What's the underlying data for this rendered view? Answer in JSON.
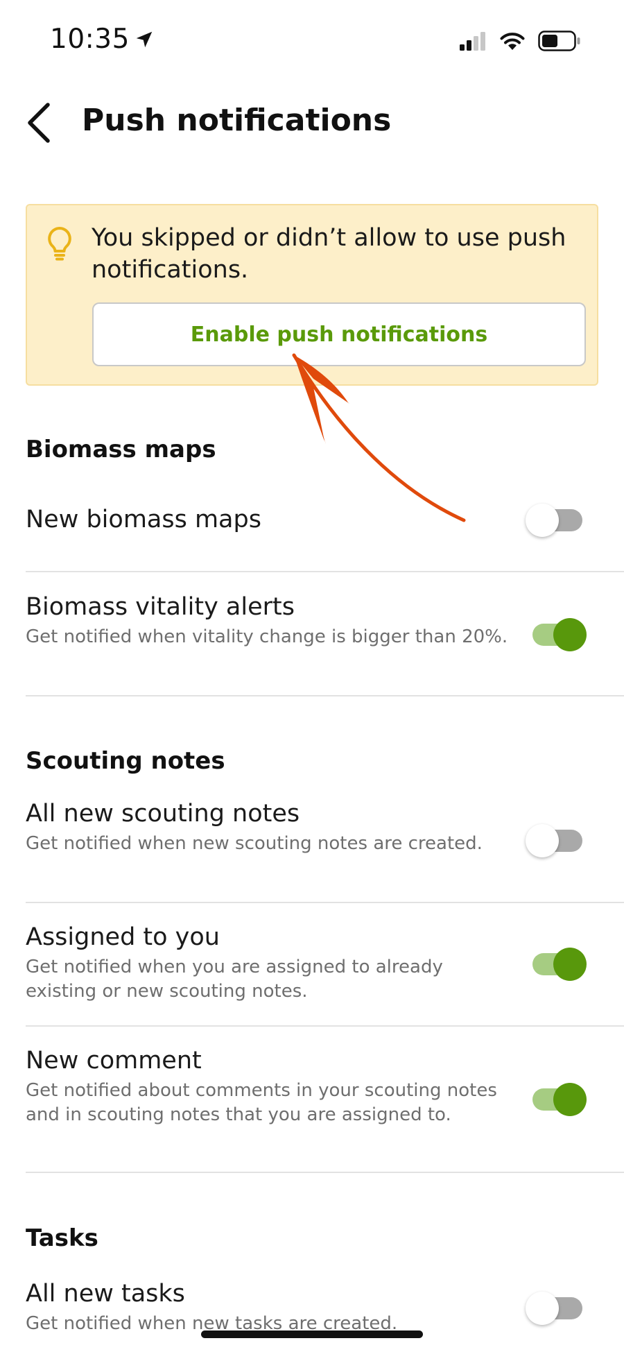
{
  "status_bar": {
    "time": "10:35",
    "icons": [
      "location-arrow-icon",
      "cellular-signal-icon",
      "wifi-icon",
      "battery-icon"
    ]
  },
  "header": {
    "title": "Push notifications",
    "back_icon": "chevron-left-icon"
  },
  "banner": {
    "icon": "lightbulb-icon",
    "message": "You skipped or didn’t allow to use push notifications.",
    "button_label": "Enable push notifications"
  },
  "sections": {
    "biomass": {
      "title": "Biomass maps",
      "items": [
        {
          "title": "New biomass maps",
          "description": "",
          "enabled": false
        },
        {
          "title": "Biomass vitality alerts",
          "description": "Get notified when vitality change is bigger than 20%.",
          "enabled": true
        }
      ]
    },
    "scouting": {
      "title": "Scouting notes",
      "items": [
        {
          "title": "All new scouting notes",
          "description": "Get notified when new scouting notes are created.",
          "enabled": false
        },
        {
          "title": "Assigned to you",
          "description": "Get notified when you are assigned to already existing or new scouting notes.",
          "enabled": true
        },
        {
          "title": "New comment",
          "description": "Get notified about comments in your scouting notes and in scouting notes that you are assigned to.",
          "enabled": true
        }
      ]
    },
    "tasks": {
      "title": "Tasks",
      "items": [
        {
          "title": "All new tasks",
          "description": "Get notified when new tasks are created.",
          "enabled": false
        }
      ]
    }
  },
  "colors": {
    "accent_green": "#58980c",
    "banner_bg": "#fdefc9",
    "arrow": "#e04a0c"
  }
}
